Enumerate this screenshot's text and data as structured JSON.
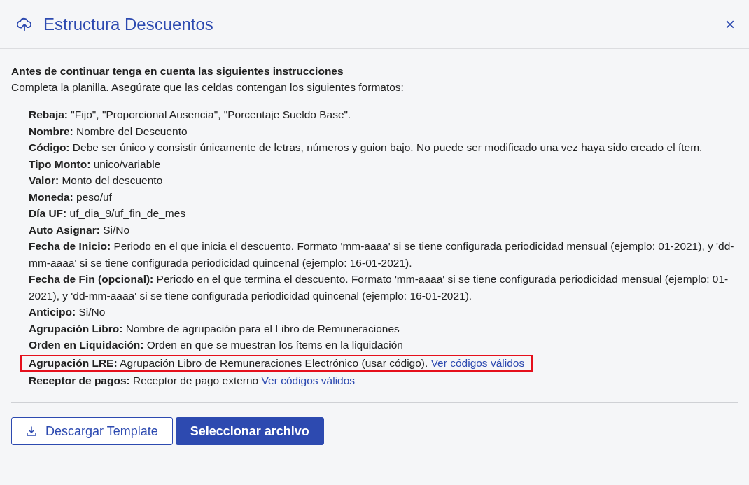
{
  "dialog": {
    "title": "Estructura Descuentos",
    "close": "×"
  },
  "intro": {
    "heading": "Antes de continuar tenga en cuenta las siguientes instrucciones",
    "text": "Completa la planilla. Asegúrate que las celdas contengan los siguientes formatos:"
  },
  "items": [
    {
      "text": "**Rebaja:** \"Fijo\", \"Proporcional Ausencia\", \"Porcentaje Sueldo Base\".",
      "highlighted": false
    },
    {
      "text": "**Nombre:** Nombre del Descuento",
      "highlighted": false
    },
    {
      "text": "**Código:** Debe ser único y consistir únicamente de letras, números y guion bajo. No puede ser modificado una vez haya sido creado el ítem.",
      "highlighted": false
    },
    {
      "text": "**Tipo Monto:** unico/variable",
      "highlighted": false
    },
    {
      "text": "**Valor:** Monto del descuento",
      "highlighted": false
    },
    {
      "text": "**Moneda:** peso/uf",
      "highlighted": false
    },
    {
      "text": "**Día UF:** uf_dia_9/uf_fin_de_mes",
      "highlighted": false
    },
    {
      "text": "**Auto Asignar:** Si/No",
      "highlighted": false
    },
    {
      "text": "**Fecha de Inicio:** Periodo en el que inicia el descuento. Formato 'mm-aaaa' si se tiene configurada periodicidad mensual (ejemplo: 01-2021), y 'dd-mm-aaaa' si se tiene configurada periodicidad quincenal (ejemplo: 16-01-2021).",
      "highlighted": false
    },
    {
      "text": "**Fecha de Fin (opcional):** Periodo en el que termina el descuento. Formato 'mm-aaaa' si se tiene configurada periodicidad mensual (ejemplo: 01-2021), y 'dd-mm-aaaa' si se tiene configurada periodicidad quincenal (ejemplo: 16-01-2021).",
      "highlighted": false
    },
    {
      "text": "**Anticipo:** Si/No",
      "highlighted": false
    },
    {
      "text": "**Agrupación Libro:** Nombre de agrupación para el Libro de Remuneraciones",
      "highlighted": false
    },
    {
      "text": "**Orden en Liquidación:** Orden en que se muestran los ítems en la liquidación",
      "highlighted": false
    },
    {
      "text": "**Agrupación LRE:** Agrupación Libro de Remuneraciones Electrónico (usar código).",
      "link": "Ver códigos válidos",
      "highlighted": true
    },
    {
      "text": "**Receptor de pagos:** Receptor de pago externo",
      "link": "Ver códigos válidos",
      "highlighted": false
    }
  ],
  "buttons": [
    {
      "label": "Descargar Template",
      "kind": "outline"
    },
    {
      "label": "Seleccionar archivo",
      "kind": "primary"
    }
  ]
}
